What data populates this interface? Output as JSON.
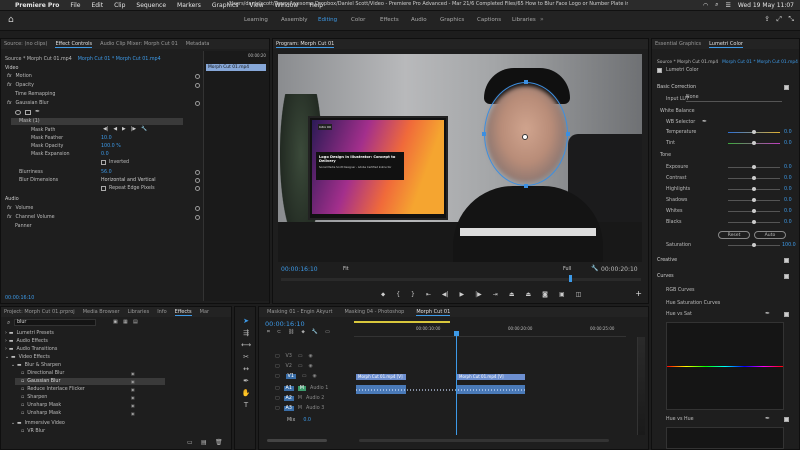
{
  "menubar": {
    "items": [
      "Premiere Pro",
      "File",
      "Edit",
      "Clip",
      "Sequence",
      "Markers",
      "Graphics",
      "View",
      "Window",
      "Help"
    ],
    "path": "/Users/danielscott/Team Awesome Dropbox/Daniel Scott/Video - Premiere Pro Advanced - Mar 21/6 Completed Files/65 How to Blur Face Logo or Number Plate in Premiere Pro.prproj *",
    "datetime": "Wed 19 May  11:07"
  },
  "workspaces": [
    "Learning",
    "Assembly",
    "Editing",
    "Color",
    "Effects",
    "Audio",
    "Graphics",
    "Captions",
    "Libraries"
  ],
  "effect_controls": {
    "tabs": [
      "Source: (no clips)",
      "Effect Controls",
      "Audio Clip Mixer: Morph Cut 01",
      "Metadata"
    ],
    "source": "Source * Morph Cut 01.mp4",
    "sequence": "Morph Cut 01 * Morph Cut 01.mp4",
    "clip_label": "Morph Cut 01.mp4",
    "timecode_mini": "00:00:20",
    "section_video": "Video",
    "motion": "Motion",
    "opacity": "Opacity",
    "time_remap": "Time Remapping",
    "gaussian": "Gaussian Blur",
    "mask_name": "Mask (1)",
    "mask_path": "Mask Path",
    "mask_feather": "Mask Feather",
    "mask_feather_val": "10.0",
    "mask_opacity": "Mask Opacity",
    "mask_opacity_val": "100.0 %",
    "mask_expansion": "Mask Expansion",
    "mask_expansion_val": "0.0",
    "inverted": "Inverted",
    "blurriness": "Blurriness",
    "blurriness_val": "56.0",
    "blur_dims": "Blur Dimensions",
    "blur_dims_val": "Horizontal and Vertical",
    "repeat_edge": "Repeat Edge Pixels",
    "section_audio": "Audio",
    "volume": "Volume",
    "channel_volume": "Channel Volume",
    "panner": "Panner",
    "timecode": "00:00:16:10"
  },
  "program": {
    "title": "Program: Morph Cut 01",
    "timecode": "00:00:16:10",
    "fit": "Fit",
    "quality": "Full",
    "duration": "00:00:20:10",
    "screen_title": "Logo Design in Illustrator: Concept to Delivery",
    "screen_sub": "Social Media Scott Designer - Adobe Certified Instructor",
    "badge": "Intro 00"
  },
  "essential": {
    "tabs": [
      "Essential Graphics",
      "Lumetri Color"
    ],
    "source": "Source * Morph Cut 01.mp4",
    "clip": "Morph Cut 01 * Morph Cut 01.mp4",
    "effect": "Lumetri Color",
    "basic": "Basic Correction",
    "input_lut": "Input LUT",
    "input_lut_val": "None",
    "white_balance": "White Balance",
    "wb_selector": "WB Selector",
    "temperature": "Temperature",
    "temperature_val": "0.0",
    "tint": "Tint",
    "tint_val": "0.0",
    "tone": "Tone",
    "exposure": "Exposure",
    "exposure_val": "0.0",
    "contrast": "Contrast",
    "contrast_val": "0.0",
    "highlights": "Highlights",
    "highlights_val": "0.0",
    "shadows": "Shadows",
    "shadows_val": "0.0",
    "whites": "Whites",
    "whites_val": "0.0",
    "blacks": "Blacks",
    "blacks_val": "0.0",
    "reset": "Reset",
    "auto": "Auto",
    "saturation": "Saturation",
    "saturation_val": "100.0",
    "creative": "Creative",
    "curves": "Curves",
    "rgb_curves": "RGB Curves",
    "hue_sat": "Hue Saturation Curves",
    "hue_vs_sat": "Hue vs Sat",
    "hue_vs_hue": "Hue vs Hue"
  },
  "effects_panel": {
    "tabs": [
      "Project: Morph Cut 01.prproj",
      "Media Browser",
      "Libraries",
      "Info",
      "Effects",
      "Mar"
    ],
    "search": "blur",
    "items": [
      "Lumetri Presets",
      "Audio Effects",
      "Audio Transitions",
      "Video Effects",
      "Blur & Sharpen",
      "Directional Blur",
      "Gaussian Blur",
      "Reduce Interlace Flicker",
      "Sharpen",
      "Unsharp Mask",
      "Unsharp Mask",
      "Immersive Video",
      "VR Blur"
    ]
  },
  "timeline": {
    "tabs": [
      "Masking 01 - Engin Akyurt",
      "Masking 04 - Photoshop",
      "Morph Cut 01"
    ],
    "timecode": "00:00:16:10",
    "ruler": [
      "00:00:10:00",
      "00:00:20:00",
      "00:00:25:00"
    ],
    "tracks_v": [
      "V3",
      "V2",
      "V1"
    ],
    "tracks_a": [
      "A1",
      "A2",
      "A3"
    ],
    "audio_names": [
      "Audio 1",
      "Audio 2",
      "Audio 3"
    ],
    "mix": "Mix",
    "mix_val": "0.0",
    "clip_v1a": "Morph Cut 01.mp4 [V]",
    "clip_v1b": "Morph Cut 01.mp4 [V]"
  }
}
